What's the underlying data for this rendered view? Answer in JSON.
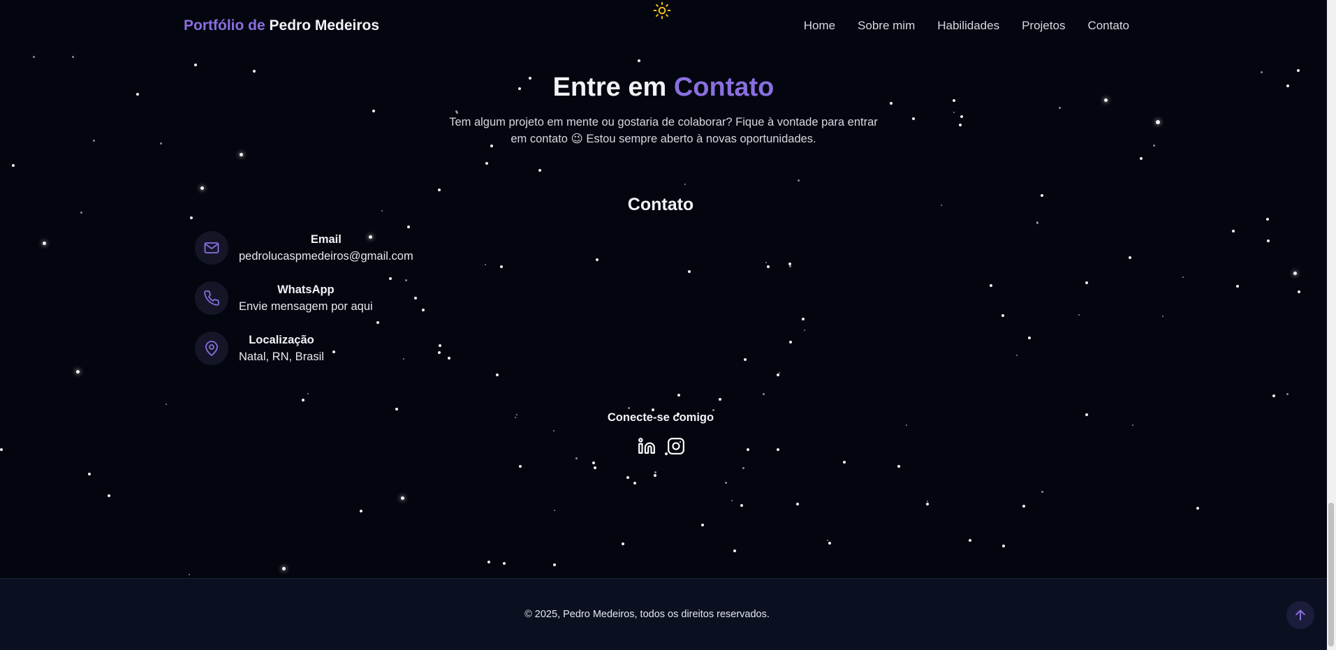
{
  "header": {
    "brand_prefix": "Portfólio de",
    "brand_name": "Pedro Medeiros",
    "theme_toggle_icon": "sun-icon",
    "nav": [
      {
        "label": "Home"
      },
      {
        "label": "Sobre mim"
      },
      {
        "label": "Habilidades"
      },
      {
        "label": "Projetos"
      },
      {
        "label": "Contato"
      }
    ]
  },
  "contact": {
    "title_prefix": "Entre em",
    "title_accent": "Contato",
    "description": "Tem algum projeto em mente ou gostaria de colaborar? Fique à vontade para entrar em contato 😉 Estou sempre aberto à novas oportunidades.",
    "heading": "Contato",
    "items": [
      {
        "icon": "mail-icon",
        "label": "Email",
        "value": "pedrolucaspmedeiros@gmail.com"
      },
      {
        "icon": "phone-icon",
        "label": "WhatsApp",
        "value": "Envie mensagem por aqui"
      },
      {
        "icon": "map-pin-icon",
        "label": "Localização",
        "value": "Natal, RN, Brasil"
      }
    ],
    "connect_title": "Conecte-se comigo",
    "socials": [
      {
        "icon": "linkedin-icon"
      },
      {
        "icon": "instagram-icon"
      }
    ]
  },
  "footer": {
    "copyright": "© 2025, Pedro Medeiros, todos os direitos reservados.",
    "back_to_top_icon": "arrow-up-icon"
  },
  "colors": {
    "background": "#04060f",
    "accent": "#8a6fe0",
    "footer_bg": "#0b1021",
    "sun": "#f5c518"
  }
}
